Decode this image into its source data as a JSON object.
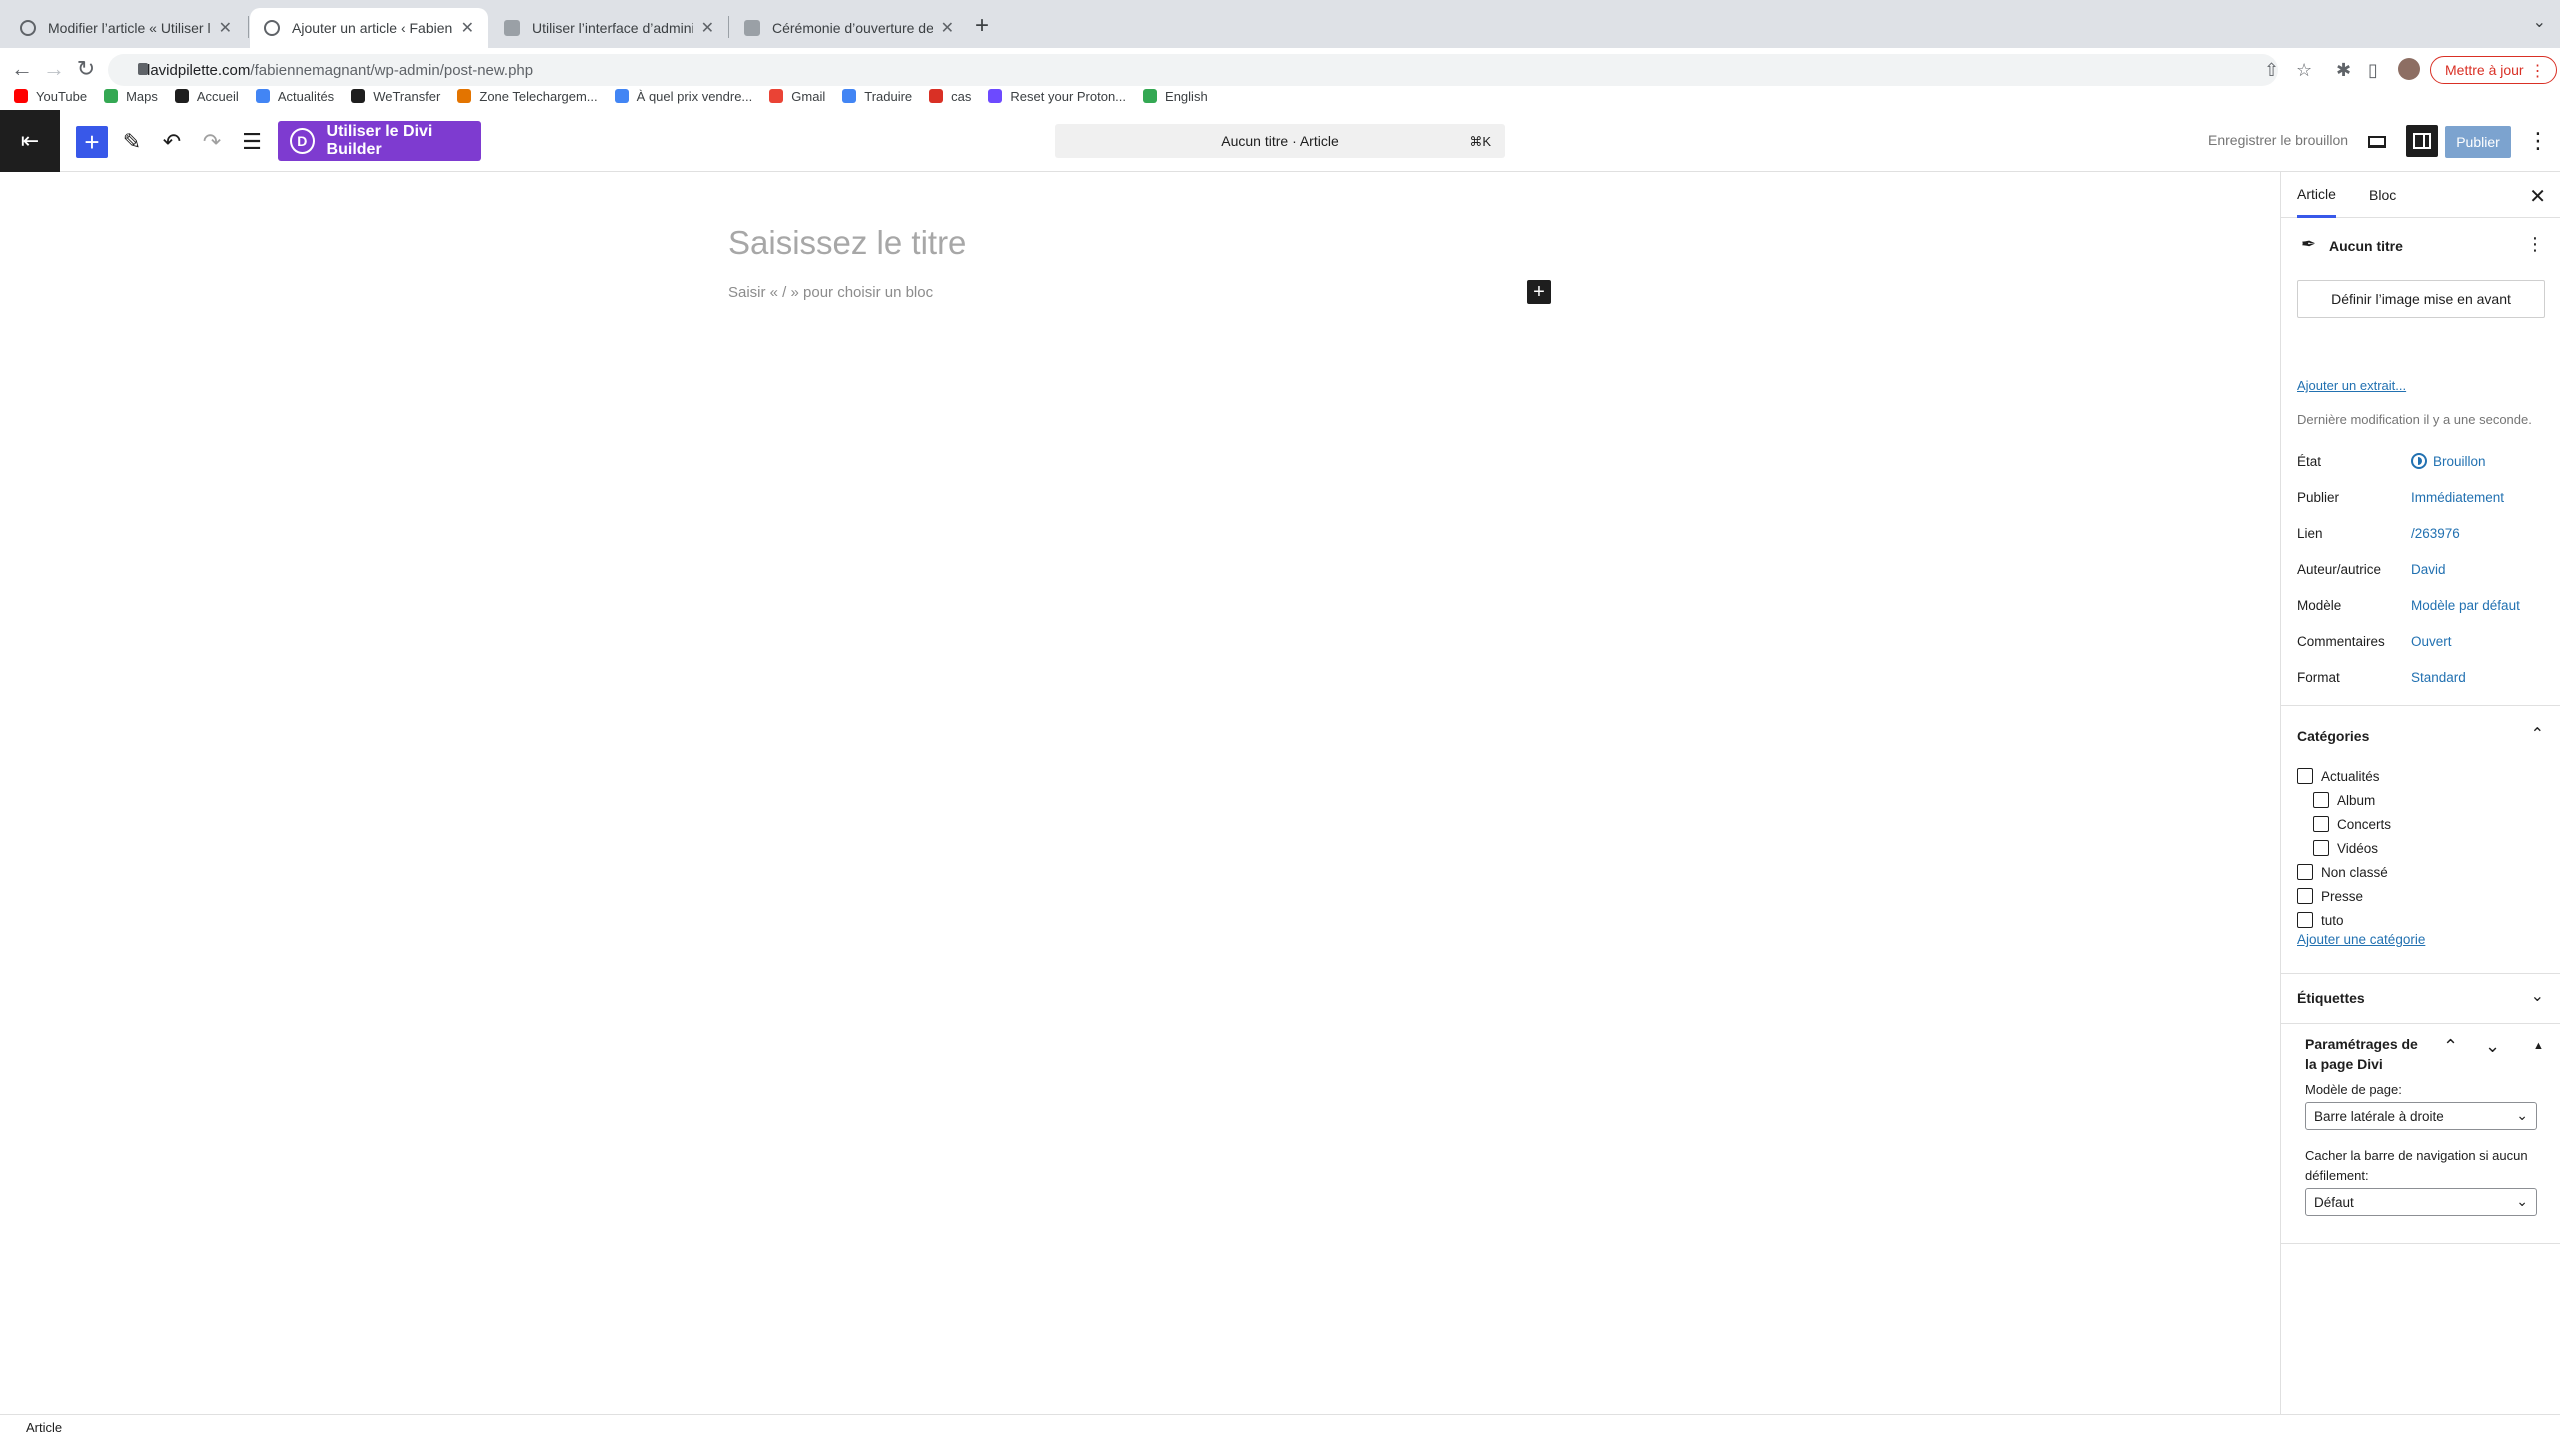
{
  "browser": {
    "tabs": [
      {
        "title": "Modifier l’article « Utiliser l’inte",
        "active": false
      },
      {
        "title": "Ajouter un article ‹ Fabienne M",
        "active": true
      },
      {
        "title": "Utiliser l’interface d’administra",
        "active": false
      },
      {
        "title": "Cérémonie d’ouverture de la sa",
        "active": false
      }
    ],
    "url_host": "davidpilette.com",
    "url_path": "/fabiennemagnant/wp-admin/post-new.php",
    "update_button": "Mettre à jour",
    "bookmarks": [
      {
        "label": "YouTube",
        "color": "#ff0000"
      },
      {
        "label": "Maps",
        "color": "#34a853"
      },
      {
        "label": "Accueil",
        "color": "#1e1e1e"
      },
      {
        "label": "Actualités",
        "color": "#4285f4"
      },
      {
        "label": "WeTransfer",
        "color": "#1e1e1e"
      },
      {
        "label": "Zone Telechargem...",
        "color": "#e37400"
      },
      {
        "label": "À quel prix vendre...",
        "color": "#4285f4"
      },
      {
        "label": "Gmail",
        "color": "#ea4335"
      },
      {
        "label": "Traduire",
        "color": "#4285f4"
      },
      {
        "label": "cas",
        "color": "#d93025"
      },
      {
        "label": "Reset your Proton...",
        "color": "#6d4aff"
      },
      {
        "label": "English",
        "color": "#34a853"
      }
    ]
  },
  "editor_header": {
    "divi_button": "Utiliser le Divi Builder",
    "divi_icon_letter": "D",
    "document_title": "Aucun titre · Article",
    "shortcut": "⌘K",
    "save_draft": "Enregistrer le brouillon",
    "publish": "Publier"
  },
  "canvas": {
    "title_placeholder": "Saisissez le titre",
    "block_prompt": "Saisir « / » pour choisir un bloc"
  },
  "sidebar": {
    "tabs": [
      "Article",
      "Bloc"
    ],
    "post_name": "Aucun titre",
    "featured_image_button": "Définir l’image mise en avant",
    "excerpt_link": "Ajouter un extrait...",
    "last_modified": "Dernière modification il y a une seconde.",
    "meta": [
      {
        "key": "État",
        "value": "Brouillon"
      },
      {
        "key": "Publier",
        "value": "Immédiatement"
      },
      {
        "key": "Lien",
        "value": "/263976"
      },
      {
        "key": "Auteur/autrice",
        "value": "David"
      },
      {
        "key": "Modèle",
        "value": "Modèle par défaut"
      },
      {
        "key": "Commentaires",
        "value": "Ouvert"
      },
      {
        "key": "Format",
        "value": "Standard"
      }
    ],
    "categories_title": "Catégories",
    "categories": [
      {
        "label": "Actualités",
        "level": 0
      },
      {
        "label": "Album",
        "level": 1
      },
      {
        "label": "Concerts",
        "level": 1
      },
      {
        "label": "Vidéos",
        "level": 1
      },
      {
        "label": "Non classé",
        "level": 0
      },
      {
        "label": "Presse",
        "level": 0
      },
      {
        "label": "tuto",
        "level": 0
      }
    ],
    "add_category": "Ajouter une catégorie",
    "tags_title": "Étiquettes",
    "divi": {
      "title": "Paramétrages de la page Divi",
      "page_layout_label": "Modèle de page:",
      "page_layout_value": "Barre latérale à droite",
      "hide_nav_label": "Cacher la barre de navigation si aucun défilement:",
      "hide_nav_value": "Défaut"
    }
  },
  "footer": {
    "breadcrumb": "Article"
  },
  "colors": {
    "wp_blue": "#3858e9",
    "divi_purple": "#7e3bd0",
    "link_blue": "#2271b1"
  }
}
